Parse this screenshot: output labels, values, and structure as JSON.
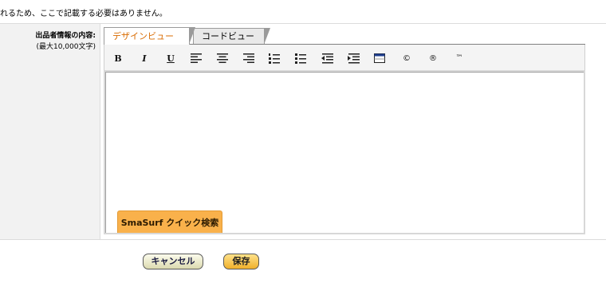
{
  "notice": {
    "text": "れるため、ここで記載する必要はありません。"
  },
  "field": {
    "label": "出品者情報の内容:",
    "sublabel": "(最大10,000文字)"
  },
  "editor": {
    "tabs": [
      {
        "label": "デザインビュー",
        "active": true
      },
      {
        "label": "コードビュー",
        "active": false
      }
    ],
    "toolbar": {
      "bold": "B",
      "italic": "I",
      "underline": "U",
      "copyright": "©",
      "registered": "®",
      "trademark": "™",
      "icons": [
        "bold-icon",
        "italic-icon",
        "underline-icon",
        "align-left-icon",
        "align-center-icon",
        "align-right-icon",
        "ordered-list-icon",
        "unordered-list-icon",
        "outdent-icon",
        "indent-icon",
        "table-icon",
        "copyright-icon",
        "registered-icon",
        "trademark-icon"
      ]
    },
    "content": "",
    "smasurf_label": "SmaSurf クイック検索"
  },
  "buttons": {
    "cancel": "キャンセル",
    "save": "保存"
  },
  "colors": {
    "active_tab_text": "#d96b00",
    "smasurf_bg": "#f9b14b",
    "save_bg": "#f0b02b",
    "cancel_bg": "#dcdab0",
    "label_bg": "#f2f2f2"
  }
}
